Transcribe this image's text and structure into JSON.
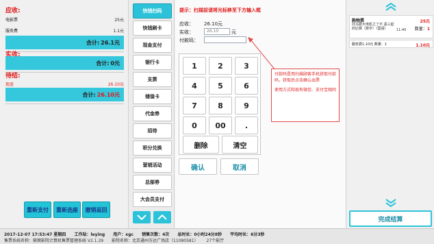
{
  "left": {
    "receivable": {
      "title": "应收:",
      "items": [
        {
          "name": "电影票",
          "value": "25元"
        },
        {
          "name": "服务费",
          "value": "1.1元"
        }
      ],
      "total_label": "合计:",
      "total_value": "26.1元"
    },
    "received": {
      "title": "实收:",
      "total_label": "合计:",
      "total_value": "0元"
    },
    "pending": {
      "title": "待结:",
      "items": [
        {
          "name": "现金",
          "value": "26.10元"
        }
      ],
      "total_label": "合计:",
      "total_value": "26.10元"
    },
    "buttons": {
      "repay": "重新支付",
      "reselect": "重新选座",
      "cancel_return": "撤销返回"
    }
  },
  "methods": {
    "items": [
      "快钱扫码",
      "快钱刷卡",
      "现金支付",
      "银行卡",
      "支票",
      "储值卡",
      "代金券",
      "招待",
      "积分兑换",
      "营销活动",
      "总部券",
      "大会员支付"
    ],
    "active_index": 0
  },
  "center": {
    "hint": "提示：扫描前请将光标移至下方输入框",
    "receivable_label": "应收：",
    "receivable_value": "26.10元",
    "received_label": "实收：",
    "received_value": "26.10",
    "received_unit": "元",
    "pay_code_label": "付款码：",
    "pay_code_value": "",
    "keys": [
      "1",
      "2",
      "3",
      "4",
      "5",
      "6",
      "7",
      "8",
      "9",
      "0",
      "00",
      "."
    ],
    "delete_label": "删除",
    "clear_label": "清空",
    "confirm_label": "确认",
    "cancel_label": "取消",
    "note_line1": "付款码是用扫描顾客手机获取付款码，获取后点击确认出票",
    "note_line2": "使用方式和现有微信、支付宝相同"
  },
  "cart": {
    "title": "购物票",
    "movie_desc": "托马斯大电影之了不 黑三起的比赛（数字）（国语）",
    "time": "11:40",
    "price": "25元",
    "qty_label": "数量：",
    "qty_value": "1",
    "service_fee": "服务费1.10元 数量：1",
    "service_price": "1.10元",
    "submit_label": "完成结算"
  },
  "status": {
    "datetime": "2017-12-07 17:53:47 星期四",
    "workstation": "工作站：leying",
    "user": "用户：xgc",
    "sales_count": "销售次数：4次",
    "total_time": "总时长：0小时24分8秒",
    "avg_time": "平均时长：6分3秒",
    "system": "售票系统名称：鼎窝影院计算机售票管理系统 V2.1.29",
    "cinema": "影院名称：北京通州万达广场店（11080581）",
    "screen": "27个影厅"
  },
  "colors": {
    "accent": "#2cc3da",
    "alert": "#e01818",
    "confirm_text": "#1c8ea8"
  }
}
